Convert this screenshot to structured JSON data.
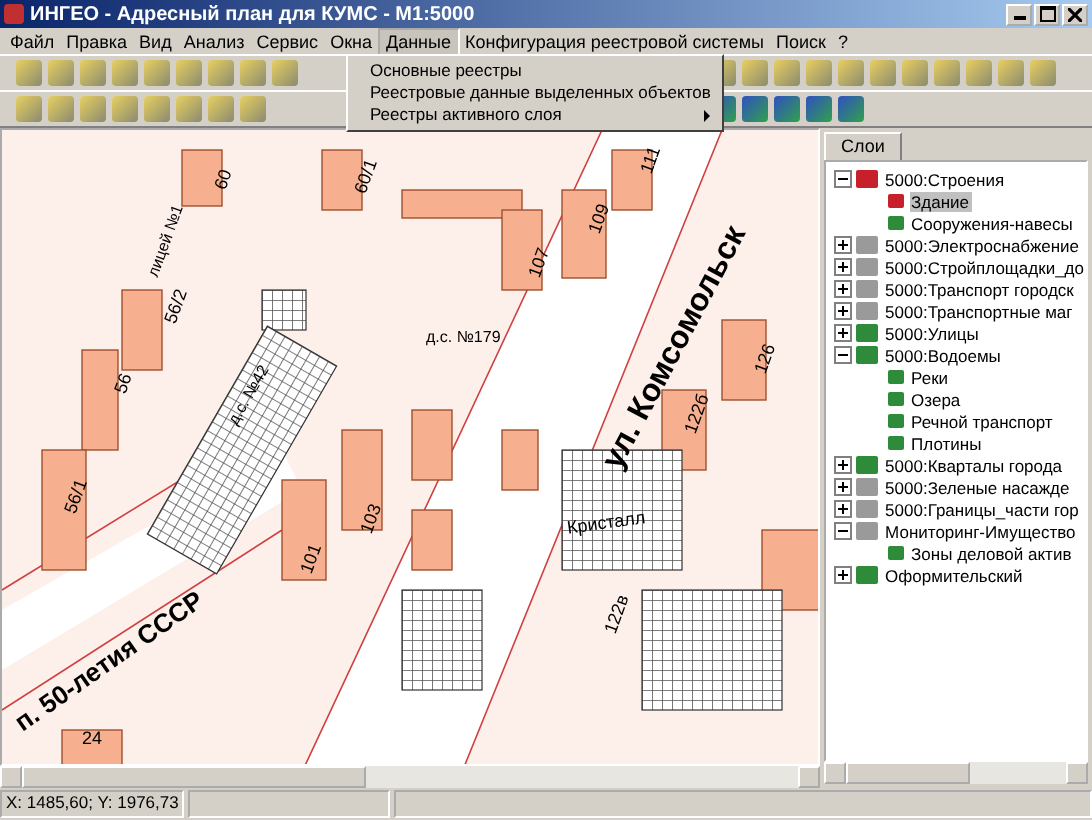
{
  "window": {
    "title": "ИНГЕО - Адресный план для КУМС - M1:5000"
  },
  "menu": [
    {
      "label": "Файл",
      "selected": false
    },
    {
      "label": "Правка",
      "selected": false
    },
    {
      "label": "Вид",
      "selected": false
    },
    {
      "label": "Анализ",
      "selected": false
    },
    {
      "label": "Сервис",
      "selected": false
    },
    {
      "label": "Окна",
      "selected": false
    },
    {
      "label": "Данные",
      "selected": true
    },
    {
      "label": "Конфигурация реестровой системы",
      "selected": false
    },
    {
      "label": "Поиск",
      "selected": false
    },
    {
      "label": "?",
      "selected": false
    }
  ],
  "dropdown": [
    {
      "label": "Основные реестры",
      "submenu": false
    },
    {
      "label": "Реестровые данные выделенных объектов",
      "submenu": false
    },
    {
      "label": "Реестры активного слоя",
      "submenu": true
    }
  ],
  "map": {
    "labels": [
      "ул. Комсомольск",
      "п. 50-летия СССР",
      "Кристалл",
      "д.с. №42",
      "д.с. №179",
      "лицей №1",
      "60",
      "60/1",
      "56/2",
      "56",
      "56/1",
      "107",
      "109",
      "111",
      "103",
      "101",
      "126",
      "122б",
      "122в",
      "24"
    ]
  },
  "panel": {
    "tabs": [
      {
        "label": "Слои",
        "selected": true
      }
    ]
  },
  "layers": [
    {
      "label": "5000:Строения",
      "kind": "active",
      "selected": false,
      "expanded": true,
      "children": [
        {
          "label": "Здание",
          "kind": "active",
          "selected": true
        },
        {
          "label": "Сооружения-навесы",
          "kind": "on",
          "selected": false
        }
      ]
    },
    {
      "label": "5000:Электроснабжение",
      "kind": "off",
      "selected": false,
      "expanded": false
    },
    {
      "label": "5000:Стройплощадки_до",
      "kind": "off",
      "selected": false,
      "expanded": false
    },
    {
      "label": "5000:Транспорт городск",
      "kind": "off",
      "selected": false,
      "expanded": false
    },
    {
      "label": "5000:Транспортные маг",
      "kind": "off",
      "selected": false,
      "expanded": false
    },
    {
      "label": "5000:Улицы",
      "kind": "on",
      "selected": false,
      "expanded": false
    },
    {
      "label": "5000:Водоемы",
      "kind": "on",
      "selected": false,
      "expanded": true,
      "children": [
        {
          "label": "Реки",
          "kind": "on",
          "selected": false
        },
        {
          "label": "Озера",
          "kind": "on",
          "selected": false
        },
        {
          "label": "Речной транспорт",
          "kind": "on",
          "selected": false
        },
        {
          "label": "Плотины",
          "kind": "on",
          "selected": false
        }
      ]
    },
    {
      "label": "5000:Кварталы города",
      "kind": "on",
      "selected": false,
      "expanded": false
    },
    {
      "label": "5000:Зеленые насажде",
      "kind": "off",
      "selected": false,
      "expanded": false
    },
    {
      "label": "5000:Границы_части гор",
      "kind": "off",
      "selected": false,
      "expanded": false
    },
    {
      "label": "Мониторинг-Имущество",
      "kind": "off",
      "selected": false,
      "expanded": true,
      "children": [
        {
          "label": "Зоны деловой актив",
          "kind": "on",
          "selected": false
        }
      ]
    },
    {
      "label": "Оформительский",
      "kind": "on",
      "selected": false,
      "expanded": false
    }
  ],
  "status_bar": {
    "coords": "X: 1485,60; Y: 1976,73"
  }
}
